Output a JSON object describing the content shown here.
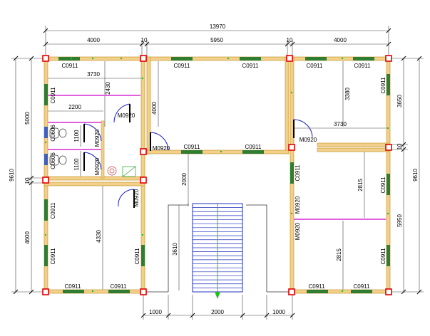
{
  "dimensions": {
    "overall_width": "13970",
    "top_segments": [
      "4000",
      "10",
      "5950",
      "10",
      "4000"
    ],
    "bottom_segments": [
      "1000",
      "2000",
      "1000"
    ],
    "left_height": "9610",
    "left_segments": [
      "5000",
      "10",
      "4600"
    ],
    "right_height": "9610",
    "right_segments": [
      "3650",
      "10",
      "5950"
    ],
    "interior": {
      "d3730_left": "3730",
      "d2430": "2430",
      "d2200": "2200",
      "d1100_a": "1100",
      "d1100_b": "1100",
      "d4000": "4000",
      "d2000": "2000",
      "d4330": "4330",
      "d3610": "3610",
      "d3380": "3380",
      "d3730_right": "3730",
      "d2815_a": "2815",
      "d2815_b": "2815"
    }
  },
  "windows": [
    "C0911",
    "C0911",
    "C0911",
    "C0911",
    "C0911",
    "C0911",
    "C0911",
    "C0911",
    "C0911",
    "C0911",
    "C0911",
    "C0911",
    "C0911",
    "C0911",
    "C0911",
    "C0911",
    "C0911",
    "C0911",
    "C0911"
  ],
  "windows_side": [
    "C0606",
    "C0606"
  ],
  "doors": [
    "M0920",
    "M0920",
    "M0920",
    "M0920",
    "M0920",
    "M0920",
    "M0920",
    "M0920"
  ],
  "colors": {
    "wall": "#f2d08a",
    "wall_edge": "#c8962e",
    "window": "#2e7d32",
    "door_arc": "#1a1acc",
    "partition": "#e060e0",
    "column": "#e00000",
    "stair": "#2030c0",
    "arrow": "#20c020",
    "dim": "#444444"
  }
}
